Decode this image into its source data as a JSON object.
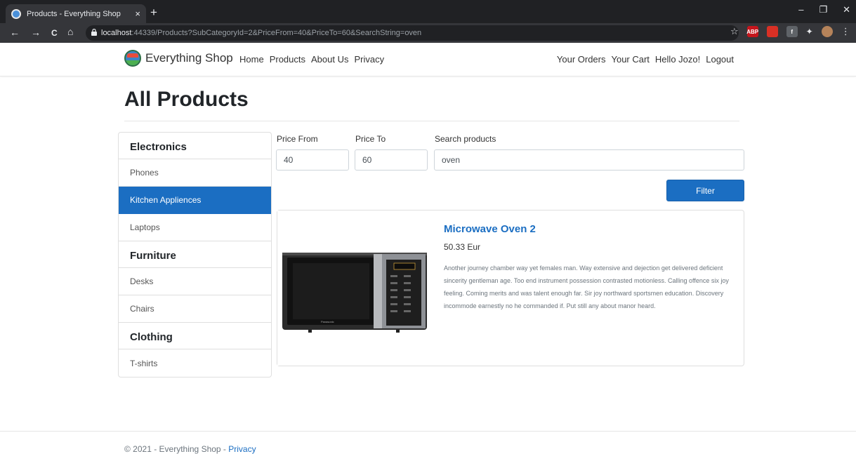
{
  "browser": {
    "tab_title": "Products - Everything Shop",
    "tab_close": "×",
    "new_tab": "+",
    "url_host": "localhost",
    "url_rest": ":44339/Products?SubCategoryId=2&PriceFrom=40&PriceTo=60&SearchString=oven",
    "nav_back": "←",
    "nav_forward": "→",
    "nav_reload": "C",
    "nav_home": "⌂",
    "win_minimize": "–",
    "win_restore": "❐",
    "win_close": "✕",
    "extensions": [
      "star-icon",
      "abp-icon",
      "calendar-icon",
      "facebook-icon",
      "puzzle-icon",
      "profile-avatar",
      "menu-icon"
    ]
  },
  "nav": {
    "brand": "Everything Shop",
    "links": [
      "Home",
      "Products",
      "About Us",
      "Privacy"
    ],
    "right_links": [
      "Your Orders",
      "Your Cart",
      "Hello Jozo!",
      "Logout"
    ]
  },
  "page": {
    "title": "All Products"
  },
  "sidebar": {
    "categories": [
      {
        "name": "Electronics",
        "items": [
          "Phones",
          "Kitchen Appliences",
          "Laptops"
        ]
      },
      {
        "name": "Furniture",
        "items": [
          "Desks",
          "Chairs"
        ]
      },
      {
        "name": "Clothing",
        "items": [
          "T-shirts"
        ]
      }
    ],
    "active_item": "Kitchen Appliences"
  },
  "filters": {
    "price_from_label": "Price From",
    "price_from_value": "40",
    "price_to_label": "Price To",
    "price_to_value": "60",
    "search_label": "Search products",
    "search_value": "oven",
    "button_label": "Filter"
  },
  "products": [
    {
      "name": "Microwave Oven 2",
      "price": "50.33 Eur",
      "description": "Another journey chamber way yet females man. Way extensive and dejection get delivered deficient sincerity gentleman age. Too end instrument possession contrasted motionless. Calling offence six joy feeling. Coming merits and was talent enough far. Sir joy northward sportsmen education. Discovery incommode earnestly no he commanded if. Put still any about manor heard.",
      "image_brand": "Panasonic"
    }
  ],
  "footer": {
    "text": "© 2021 - Everything Shop - ",
    "link": "Privacy"
  },
  "colors": {
    "primary": "#1b6ec2",
    "browser_dark": "#202124",
    "browser_tab": "#35363a"
  }
}
